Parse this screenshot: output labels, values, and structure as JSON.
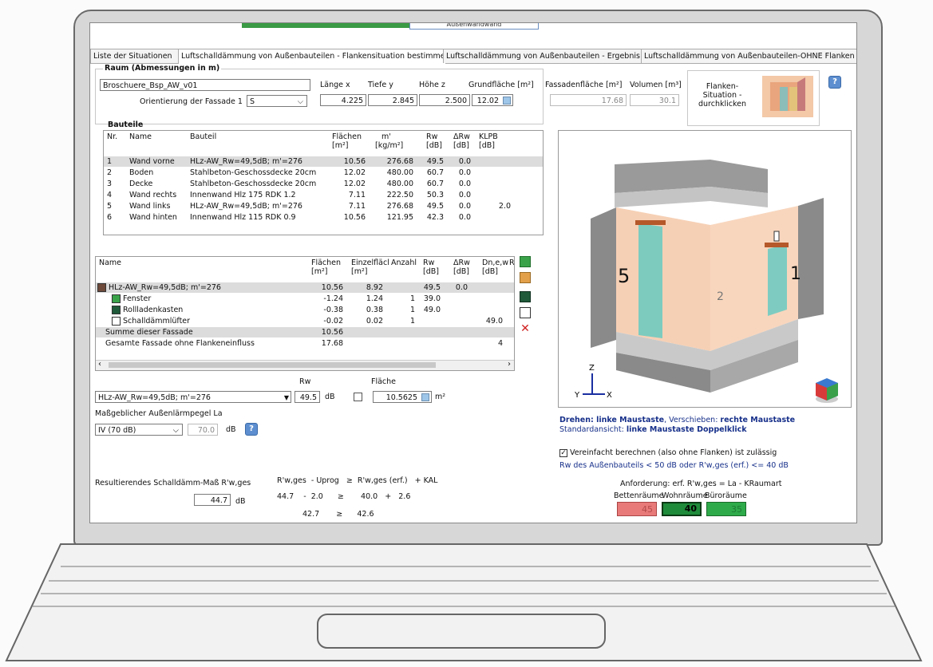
{
  "tabs": [
    {
      "label": "Liste der Situationen"
    },
    {
      "label": "Luftschalldämmung von Außenbauteilen - Flankensituation bestimmen"
    },
    {
      "label": "Luftschalldämmung von Außenbauteilen - Ergebnis"
    },
    {
      "label": "Luftschalldämmung von Außenbauteilen-OHNE Flanken"
    }
  ],
  "raum": {
    "heading": "Raum (Abmessungen in m)",
    "name": "Broschuere_Bsp_AW_v01",
    "orient_label": "Orientierung der Fassade 1",
    "orient_value": "S",
    "laenge_label": "Länge x",
    "laenge": "4.225",
    "tiefe_label": "Tiefe y",
    "tiefe": "2.845",
    "hoehe_label": "Höhe z",
    "hoehe": "2.500",
    "grund_label": "Grundfläche [m²]",
    "grund": "12.02",
    "fassade_label": "Fassadenfläche [m²]",
    "fassade": "17.68",
    "volumen_label": "Volumen [m³]",
    "volumen": "30.1",
    "flanken_btn": "Flanken-\nSituation -\ndurchklicken"
  },
  "bauteile": {
    "heading": "Bauteile",
    "headers": {
      "nr": "Nr.",
      "name": "Name",
      "bauteil": "Bauteil",
      "flaechen": "Flächen",
      "flaechen_u": "[m²]",
      "m": "m'",
      "m_u": "[kg/m²]",
      "rw": "Rw",
      "rw_u": "[dB]",
      "drw": "ΔRw",
      "drw_u": "[dB]",
      "klpb": "KLPB",
      "klpb_u": "[dB]"
    },
    "rows": [
      {
        "nr": "1",
        "name": "Wand vorne",
        "bauteil": "HLz-AW_Rw=49,5dB; m'=276",
        "fl": "10.56",
        "m": "276.68",
        "rw": "49.5",
        "drw": "0.0",
        "k": ""
      },
      {
        "nr": "2",
        "name": "Boden",
        "bauteil": "Stahlbeton-Geschossdecke 20cm",
        "fl": "12.02",
        "m": "480.00",
        "rw": "60.7",
        "drw": "0.0",
        "k": ""
      },
      {
        "nr": "3",
        "name": "Decke",
        "bauteil": "Stahlbeton-Geschossdecke 20cm",
        "fl": "12.02",
        "m": "480.00",
        "rw": "60.7",
        "drw": "0.0",
        "k": ""
      },
      {
        "nr": "4",
        "name": "Wand rechts",
        "bauteil": "Innenwand Hlz 175 RDK 1.2",
        "fl": "7.11",
        "m": "222.50",
        "rw": "50.3",
        "drw": "0.0",
        "k": ""
      },
      {
        "nr": "5",
        "name": "Wand links",
        "bauteil": "HLz-AW_Rw=49,5dB; m'=276",
        "fl": "7.11",
        "m": "276.68",
        "rw": "49.5",
        "drw": "0.0",
        "k": "2.0"
      },
      {
        "nr": "6",
        "name": "Wand hinten",
        "bauteil": "Innenwand Hlz 115 RDK 0.9",
        "fl": "10.56",
        "m": "121.95",
        "rw": "42.3",
        "drw": "0.0",
        "k": ""
      }
    ]
  },
  "fassade": {
    "headers": {
      "name": "Name",
      "flaechen": "Flächen",
      "flaechen_u": "[m²]",
      "einzel": "Einzelfläcl",
      "einzel_u": "[m²]",
      "anzahl": "Anzahl",
      "rw": "Rw",
      "rw_u": "[dB]",
      "drw": "ΔRw",
      "drw_u": "[dB]",
      "dn": "Dn,e,w",
      "dn_u": "[dB]",
      "r": "R",
      "r_u": "[d"
    },
    "rows": [
      {
        "name": "HLz-AW_Rw=49,5dB; m'=276",
        "fl": "10.56",
        "ez": "8.92",
        "an": "",
        "rw": "49.5",
        "drw": "0.0",
        "dn": ""
      },
      {
        "name": "Fenster",
        "fl": "-1.24",
        "ez": "1.24",
        "an": "1",
        "rw": "39.0",
        "drw": "",
        "dn": ""
      },
      {
        "name": "Rollladenkasten",
        "fl": "-0.38",
        "ez": "0.38",
        "an": "1",
        "rw": "49.0",
        "drw": "",
        "dn": ""
      },
      {
        "name": "Schalldämmlüfter",
        "fl": "-0.02",
        "ez": "0.02",
        "an": "1",
        "rw": "",
        "drw": "",
        "dn": "49.0"
      },
      {
        "name": "Summe dieser Fassade",
        "fl": "10.56",
        "ez": "",
        "an": "",
        "rw": "",
        "drw": "",
        "dn": ""
      },
      {
        "name": "Gesamte Fassade ohne Flankeneinfluss",
        "fl": "17.68",
        "ez": "",
        "an": "",
        "rw": "",
        "drw": "",
        "dn": "4"
      }
    ]
  },
  "editor": {
    "rw_label": "Rw",
    "flaeche_label": "Fläche",
    "bauteil_select": "HLz-AW_Rw=49,5dB; m'=276",
    "rw_value": "49.5",
    "db": "dB",
    "flaeche_value": "10.5625",
    "m2": "m²",
    "aussenlaerm_label": "Maßgeblicher Außenlärmpegel La",
    "aussenlaerm_value": "IV (70 dB)",
    "aussenlaerm_db": "70.0",
    "db2": "dB"
  },
  "result": {
    "label": "Resultierendes Schalldämm-Maß R'w,ges",
    "value": "44.7",
    "db": "dB",
    "formula": "R'w,ges  - Uprog   ≥  R'w,ges (erf.)   + KAL",
    "line1": "44.7    -  2.0      ≥       40.0   +   2.6",
    "line2": "42.7       ≥      42.6"
  },
  "view3d": {
    "help1_a": "Drehen: ",
    "help1_b": "linke Maustaste",
    "help1_c": ", Verschieben: ",
    "help1_d": "rechte Maustaste",
    "help2_a": "Standardansicht: ",
    "help2_b": "linke Maustaste Doppelklick",
    "label_5": "5",
    "label_1": "1",
    "label_2": "2",
    "axis_z": "Z",
    "axis_y": "Y",
    "axis_x": "X"
  },
  "anforderung": {
    "checkbox_label": "Vereinfacht berechnen (also ohne Flanken) ist zulässig",
    "rw_condition": "Rw  des Außenbauteils < 50 dB oder R'w,ges (erf.)   <= 40 dB",
    "title": "Anforderung: erf. R'w,ges  = La  - KRaumart",
    "col1": "Bettenräume",
    "col2": "Wohnräume",
    "col3": "Büroräume",
    "val1": "45",
    "val2": "40",
    "val3": "35",
    "color1": "#e57373",
    "color2": "#1e8b3a",
    "color3": "#2eaa4a"
  },
  "top_tab_stub": "Außenwandwand"
}
